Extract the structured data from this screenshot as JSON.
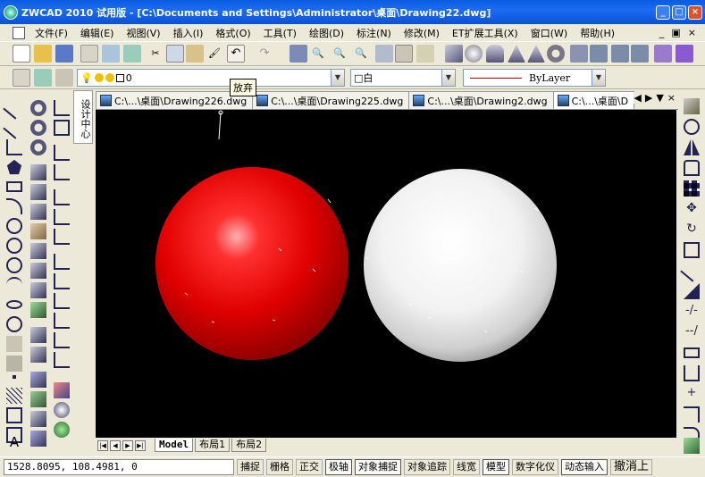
{
  "window": {
    "title": "ZWCAD 2010 试用版 - [C:\\Documents and Settings\\Administrator\\桌面\\Drawing22.dwg]",
    "min": "_",
    "max": "□",
    "close": "×"
  },
  "menu": {
    "items": [
      "文件(F)",
      "编辑(E)",
      "视图(V)",
      "插入(I)",
      "格式(O)",
      "工具(T)",
      "绘图(D)",
      "标注(N)",
      "修改(M)",
      "ET扩展工具(X)",
      "窗口(W)",
      "帮助(H)"
    ],
    "mdi_min": "_",
    "mdi_restore": "▣",
    "mdi_close": "×"
  },
  "properties": {
    "layer_value": "0",
    "color_value": "□白",
    "linetype_value": "ByLayer"
  },
  "tooltip": "放弃",
  "palette_tab": "设计中心",
  "document_tabs": [
    {
      "label": "C:\\...\\桌面\\Drawing226.dwg",
      "active": false
    },
    {
      "label": "C:\\...\\桌面\\Drawing225.dwg",
      "active": false
    },
    {
      "label": "C:\\...\\桌面\\Drawing2.dwg",
      "active": false
    },
    {
      "label": "C:\\...\\桌面\\D",
      "active": true
    }
  ],
  "tab_controls": [
    "◀",
    "▶",
    "▼",
    "×"
  ],
  "layout_tabs": [
    {
      "label": "Model",
      "active": true
    },
    {
      "label": "布局1",
      "active": false
    },
    {
      "label": "布局2",
      "active": false
    }
  ],
  "status": {
    "coords": "1528.8095, 108.4981, 0",
    "buttons": [
      {
        "label": "捕捉",
        "on": false
      },
      {
        "label": "栅格",
        "on": false
      },
      {
        "label": "正交",
        "on": false
      },
      {
        "label": "极轴",
        "on": true
      },
      {
        "label": "对象捕捉",
        "on": true
      },
      {
        "label": "对象追踪",
        "on": false
      },
      {
        "label": "线宽",
        "on": false
      },
      {
        "label": "模型",
        "on": true
      },
      {
        "label": "数字化仪",
        "on": false
      },
      {
        "label": "动态输入",
        "on": true
      },
      {
        "label": "撤消上",
        "on": false
      }
    ]
  },
  "canvas_objects": {
    "sphere_red_color": "#ff0000",
    "sphere_white_color": "#ffffff"
  },
  "colors": {
    "titlebar": "#0a5be0",
    "canvas_bg": "#000000",
    "chrome": "#ece9d8"
  }
}
